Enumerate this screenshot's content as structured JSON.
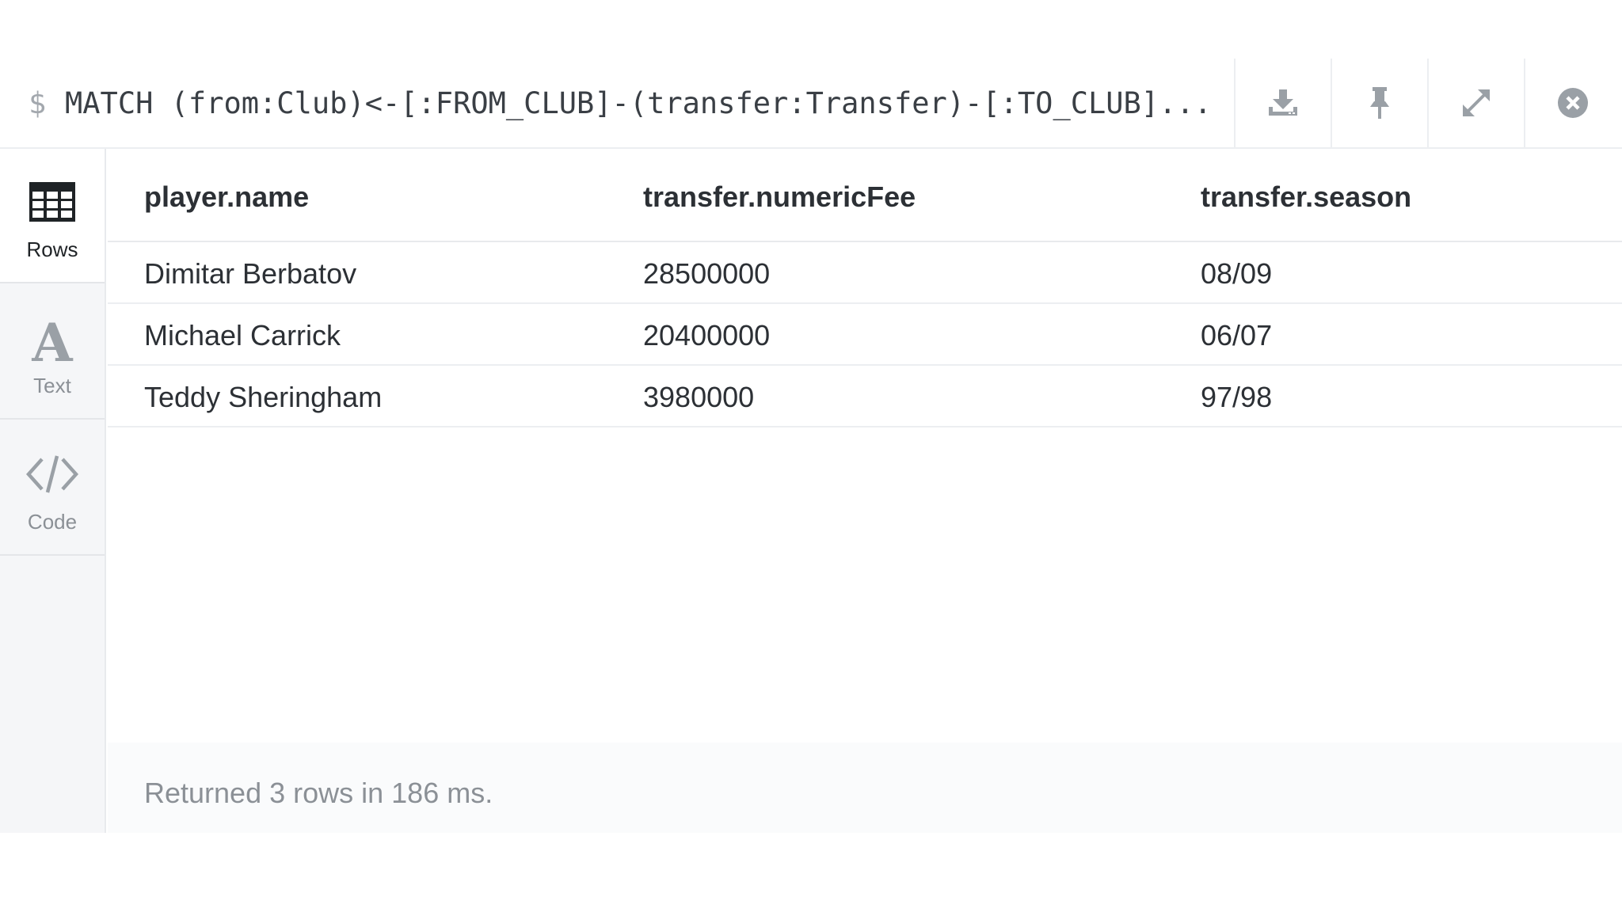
{
  "query": {
    "prompt_symbol": "$",
    "text": "MATCH (from:Club)<-[:FROM_CLUB]-(transfer:Transfer)-[:TO_CLUB]..."
  },
  "toolbar": {
    "buttons": [
      {
        "icon": "download-icon"
      },
      {
        "icon": "pin-icon"
      },
      {
        "icon": "expand-icon"
      },
      {
        "icon": "close-icon"
      }
    ]
  },
  "sidebar": {
    "items": [
      {
        "label": "Rows",
        "icon": "table-icon",
        "active": true
      },
      {
        "label": "Text",
        "icon": "text-icon",
        "active": false
      },
      {
        "label": "Code",
        "icon": "code-icon",
        "active": false
      }
    ]
  },
  "table": {
    "columns": [
      "player.name",
      "transfer.numericFee",
      "transfer.season"
    ],
    "rows": [
      [
        "Dimitar Berbatov",
        "28500000",
        "08/09"
      ],
      [
        "Michael Carrick",
        "20400000",
        "06/07"
      ],
      [
        "Teddy Sheringham",
        "3980000",
        "97/98"
      ]
    ]
  },
  "status": {
    "text": "Returned 3 rows in 186 ms."
  },
  "colors": {
    "icon_gray": "#9aa0a6",
    "text_dark": "#2c3035",
    "text_muted": "#8b9096",
    "sidebar_bg": "#f5f6f8"
  }
}
